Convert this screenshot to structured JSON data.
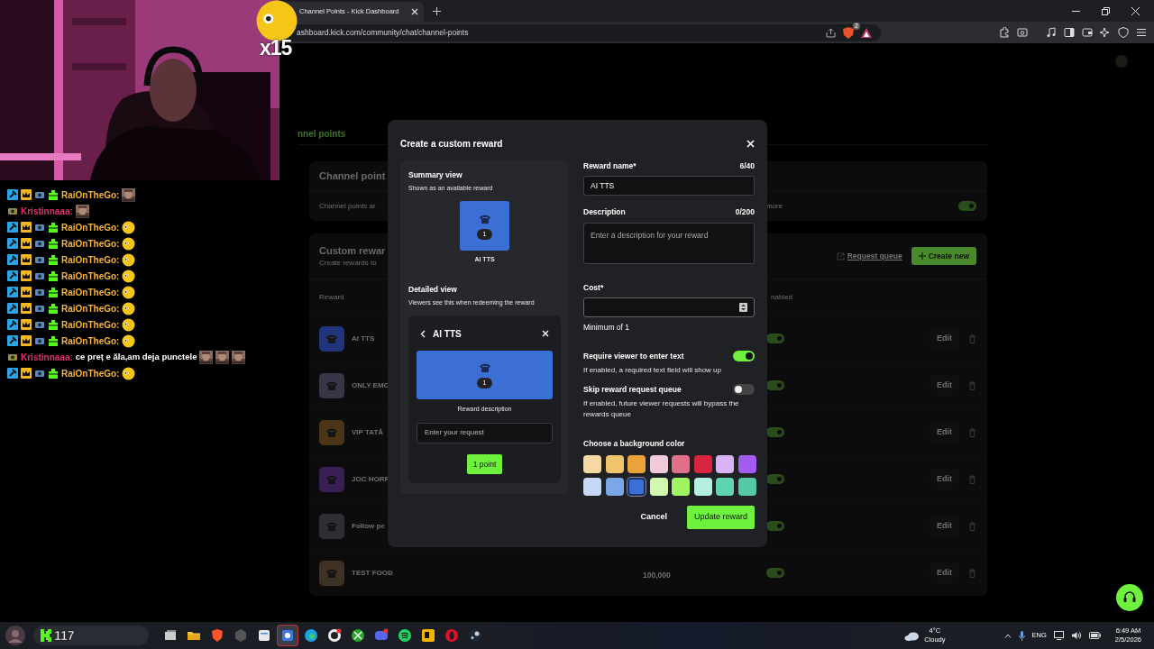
{
  "browser": {
    "tab": {
      "title": "Channel Points - Kick Dashboard",
      "selected": true
    },
    "address": "ashboard.kick.com/community/chat/channel-points",
    "shield_badge": "2"
  },
  "overlay": {
    "combo": "x15",
    "chat": [
      {
        "kind": "subscriber",
        "user": "RaiOnTheGo:",
        "color": "#f5b342",
        "parts": [
          {
            "kind": "picture"
          }
        ]
      },
      {
        "kind": "viewer",
        "user": "Kristinnaaa:",
        "color": "#e0306a",
        "parts": [
          {
            "kind": "picture"
          }
        ]
      },
      {
        "kind": "subscriber",
        "user": "RaiOnTheGo:",
        "color": "#f5b342",
        "parts": [
          {
            "kind": "emoji"
          }
        ]
      },
      {
        "kind": "subscriber",
        "user": "RaiOnTheGo:",
        "color": "#f5b342",
        "parts": [
          {
            "kind": "emoji"
          }
        ]
      },
      {
        "kind": "subscriber",
        "user": "RaiOnTheGo:",
        "color": "#f5b342",
        "parts": [
          {
            "kind": "emoji"
          }
        ]
      },
      {
        "kind": "subscriber",
        "user": "RaiOnTheGo:",
        "color": "#f5b342",
        "parts": [
          {
            "kind": "emoji"
          }
        ]
      },
      {
        "kind": "subscriber",
        "user": "RaiOnTheGo:",
        "color": "#f5b342",
        "parts": [
          {
            "kind": "emoji"
          }
        ]
      },
      {
        "kind": "subscriber",
        "user": "RaiOnTheGo:",
        "color": "#f5b342",
        "parts": [
          {
            "kind": "emoji"
          }
        ]
      },
      {
        "kind": "subscriber",
        "user": "RaiOnTheGo:",
        "color": "#f5b342",
        "parts": [
          {
            "kind": "emoji"
          }
        ]
      },
      {
        "kind": "subscriber",
        "user": "RaiOnTheGo:",
        "color": "#f5b342",
        "parts": [
          {
            "kind": "emoji"
          }
        ]
      },
      {
        "kind": "viewer",
        "user": "Kristinnaaa:",
        "color": "#e0306a",
        "parts": [
          {
            "kind": "text",
            "text": "ce preț e ăla,am deja punctele"
          },
          {
            "kind": "picture"
          },
          {
            "kind": "picture"
          },
          {
            "kind": "picture"
          }
        ]
      },
      {
        "kind": "subscriber",
        "user": "RaiOnTheGo:",
        "color": "#f5b342",
        "parts": [
          {
            "kind": "emoji"
          }
        ]
      }
    ]
  },
  "dashboard": {
    "page_tab": "nnel points",
    "settings_card": {
      "title": "Channel point",
      "text": "Channel points ar",
      "more": "more",
      "enabled": true
    },
    "rewards_card": {
      "title": "Custom rewar",
      "subtitle": "Create rewards to",
      "request_queue": "Request queue",
      "create_button": "Create new"
    },
    "table": {
      "columns": [
        "Reward",
        "nabled"
      ],
      "rows": [
        {
          "name": "AI TTS",
          "color": "#22357a",
          "enabled": true,
          "edit": "Edit"
        },
        {
          "name": "ONLY EMO",
          "color": "#3a3447",
          "enabled": true,
          "edit": "Edit"
        },
        {
          "name": "VIP TATĂ",
          "color": "#4a3517",
          "enabled": true,
          "edit": "Edit"
        },
        {
          "name": "JOC HORR",
          "color": "#3a1f55",
          "enabled": true,
          "edit": "Edit"
        },
        {
          "name": "Follow pe",
          "color": "#2e2e33",
          "enabled": true,
          "edit": "Edit"
        },
        {
          "name": "TEST FOOD",
          "color": "#3d3224",
          "cost": "100,000",
          "enabled": true,
          "edit": "Edit"
        }
      ]
    }
  },
  "modal": {
    "title": "Create a custom reward",
    "summary": {
      "heading": "Summary view",
      "subtitle": "Shown as an available reward",
      "badge": "1",
      "label": "AI TTS"
    },
    "detailed": {
      "heading": "Detailed view",
      "subtitle": "Viewers see this when redeeming the reward",
      "title": "AI TTS",
      "badge": "1",
      "description": "Reward description",
      "input_placeholder": "Enter your request",
      "button": "1 point"
    },
    "form": {
      "name": {
        "label": "Reward name*",
        "counter": "6/40",
        "value": "AI TTS"
      },
      "description": {
        "label": "Description",
        "counter": "0/200",
        "placeholder": "Enter a description for your reward"
      },
      "cost": {
        "label": "Cost*",
        "hint": "Minimum of 1"
      },
      "toggles": [
        {
          "label": "Require viewer to enter text",
          "help": "If enabled, a required text field will show up",
          "on": true
        },
        {
          "label": "Skip reward request queue",
          "help": "If enabled, future viewer requests will bypass the rewards queue",
          "on": false
        }
      ],
      "colors_label": "Choose a background color",
      "colors": [
        {
          "color": "#f5d9a0",
          "selected": false
        },
        {
          "color": "#f0c46c",
          "selected": false
        },
        {
          "color": "#e8a33a",
          "selected": false
        },
        {
          "color": "#f2c9d8",
          "selected": false
        },
        {
          "color": "#e0708a",
          "selected": false
        },
        {
          "color": "#d9253f",
          "selected": false
        },
        {
          "color": "#d9b3f5",
          "selected": false
        },
        {
          "color": "#a35bf0",
          "selected": false
        },
        {
          "color": "#c5d9f7",
          "selected": false
        },
        {
          "color": "#7ba6e8",
          "selected": false
        },
        {
          "color": "#3b6fd6",
          "selected": true
        },
        {
          "color": "#d2f7b0",
          "selected": false
        },
        {
          "color": "#9ef55f",
          "selected": false
        },
        {
          "color": "#b4f0e0",
          "selected": false
        },
        {
          "color": "#5fd4b0",
          "selected": false
        },
        {
          "color": "#55c9a5",
          "selected": false
        }
      ]
    },
    "buttons": {
      "cancel": "Cancel",
      "submit": "Update reward"
    }
  },
  "taskbar": {
    "viewer_count": "117",
    "apps": [
      {
        "kind": "taskview",
        "selected": false
      },
      {
        "kind": "folder",
        "selected": false
      },
      {
        "kind": "brave",
        "selected": false
      },
      {
        "kind": "hex",
        "selected": false
      },
      {
        "kind": "notes",
        "selected": false
      },
      {
        "kind": "share",
        "selected": true
      },
      {
        "kind": "edge",
        "selected": false
      },
      {
        "kind": "cat",
        "selected": false
      },
      {
        "kind": "xbox",
        "selected": false
      },
      {
        "kind": "discord",
        "selected": false
      },
      {
        "kind": "spotify",
        "selected": false
      },
      {
        "kind": "rockstar",
        "selected": false
      },
      {
        "kind": "opera",
        "selected": false
      },
      {
        "kind": "steam",
        "selected": false
      }
    ],
    "weather": {
      "temp": "4°C",
      "text": "Cloudy"
    },
    "language": "ENG",
    "time": "6:49 AM",
    "date": "2/5/2026"
  }
}
